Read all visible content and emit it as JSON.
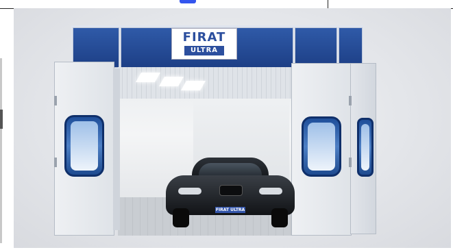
{
  "image": {
    "logo": {
      "brand": "FIRAT",
      "sub": "ULTRA"
    },
    "plate_text": "FIRAT ULTRA"
  }
}
